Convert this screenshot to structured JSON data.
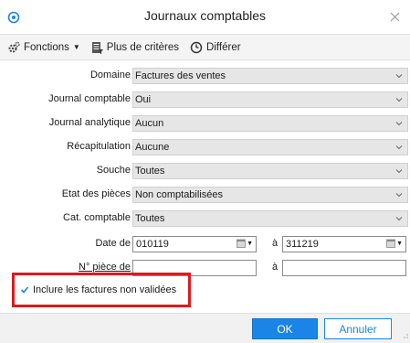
{
  "window": {
    "title": "Journaux comptables",
    "app_icon": "app-logo-icon",
    "close_icon": "close-icon"
  },
  "toolbar": {
    "fonctions_label": "Fonctions",
    "criteres_label": "Plus de critères",
    "differer_label": "Différer"
  },
  "form": {
    "domaine": {
      "label": "Domaine",
      "value": "Factures des ventes"
    },
    "journal_comptable": {
      "label": "Journal comptable",
      "value": "Oui"
    },
    "journal_analytique": {
      "label": "Journal analytique",
      "value": "Aucun"
    },
    "recapitulation": {
      "label": "Récapitulation",
      "value": "Aucune"
    },
    "souche": {
      "label": "Souche",
      "value": "Toutes"
    },
    "etat_pieces": {
      "label": "Etat des pièces",
      "value": "Non comptabilisées"
    },
    "cat_comptable": {
      "label": "Cat. comptable",
      "value": "Toutes"
    },
    "date": {
      "label": "Date de",
      "from": "010119",
      "to_label": "à",
      "to": "311219"
    },
    "piece": {
      "label": "N° pièce de",
      "from": "",
      "to_label": "à",
      "to": ""
    },
    "include_unvalidated": {
      "label": "Inclure les factures non validées",
      "checked": true
    }
  },
  "footer": {
    "ok_label": "OK",
    "cancel_label": "Annuler"
  },
  "colors": {
    "accent": "#1a85e6",
    "highlight": "#e0191e",
    "combo_bg": "#e6e6e6"
  }
}
